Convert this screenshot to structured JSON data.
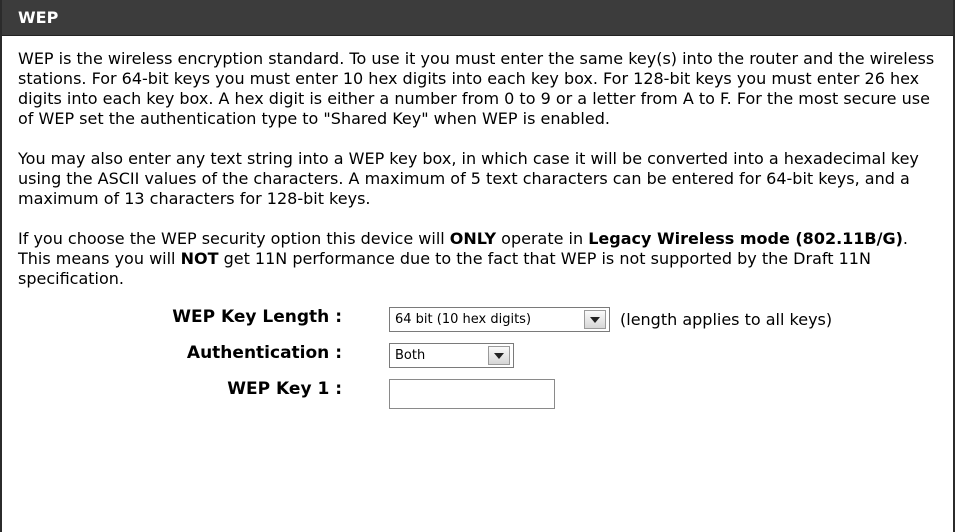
{
  "header": {
    "title": "WEP"
  },
  "description": {
    "para1": "WEP is the wireless encryption standard. To use it you must enter the same key(s) into the router and the wireless stations. For 64-bit keys you must enter 10 hex digits into each key box. For 128-bit keys you must enter 26 hex digits into each key box. A hex digit is either a number from 0 to 9 or a letter from A to F. For the most secure use of WEP set the authentication type to \"Shared Key\" when WEP is enabled.",
    "para2": "You may also enter any text string into a WEP key box, in which case it will be converted into a hexadecimal key using the ASCII values of the characters. A maximum of 5 text characters can be entered for 64-bit keys, and a maximum of 13 characters for 128-bit keys.",
    "para3_part1": "If you choose the WEP security option this device will ",
    "para3_bold1": "ONLY",
    "para3_part2": " operate in ",
    "para3_bold2": "Legacy Wireless mode (802.11B/G)",
    "para3_part3": ". This means you will ",
    "para3_bold3": "NOT",
    "para3_part4": " get 11N performance due to the fact that WEP is not supported by the Draft 11N specification."
  },
  "form": {
    "key_length": {
      "label": "WEP Key Length :",
      "value": "64 bit (10 hex digits)",
      "hint": "(length applies to all keys)"
    },
    "authentication": {
      "label": "Authentication :",
      "value": "Both"
    },
    "key1": {
      "label": "WEP Key 1 :",
      "value": ""
    }
  }
}
